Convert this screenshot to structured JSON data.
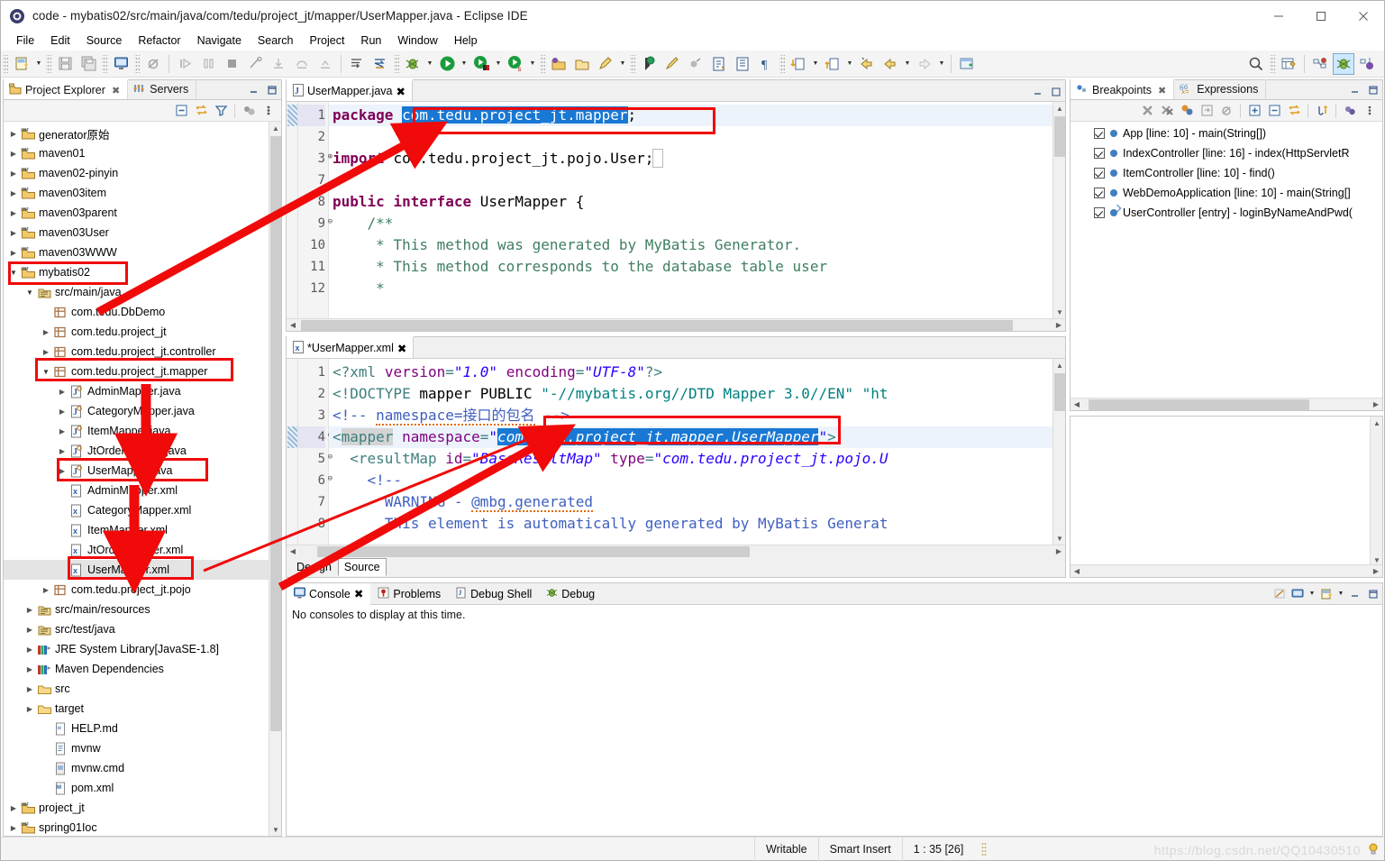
{
  "window": {
    "title": "code - mybatis02/src/main/java/com/tedu/project_jt/mapper/UserMapper.java - Eclipse IDE",
    "minimize": "—",
    "maximize": "□",
    "close": "✕"
  },
  "menu": [
    "File",
    "Edit",
    "Source",
    "Refactor",
    "Navigate",
    "Search",
    "Project",
    "Run",
    "Window",
    "Help"
  ],
  "project_explorer": {
    "tabs": [
      {
        "label": "Project Explorer",
        "icon": "project-explorer-icon",
        "selected": true,
        "close": "✖"
      },
      {
        "label": "Servers",
        "icon": "servers-icon",
        "selected": false
      }
    ],
    "view_buttons": [
      "minimize-view",
      "maximize-view"
    ],
    "toolbar_icons": [
      "collapse-all-icon",
      "link-with-editor-icon",
      "filter-icon",
      "focus-icon",
      "view-menu-icon"
    ],
    "tree": [
      {
        "label": "generator原始",
        "icon": "maven-project-icon",
        "indent": 0,
        "arrow": "collapsed"
      },
      {
        "label": "maven01",
        "icon": "maven-project-icon",
        "indent": 0,
        "arrow": "collapsed"
      },
      {
        "label": "maven02-pinyin",
        "icon": "maven-project-icon",
        "indent": 0,
        "arrow": "collapsed"
      },
      {
        "label": "maven03item",
        "icon": "maven-project-icon",
        "indent": 0,
        "arrow": "collapsed"
      },
      {
        "label": "maven03parent",
        "icon": "maven-project-icon",
        "indent": 0,
        "arrow": "collapsed"
      },
      {
        "label": "maven03User",
        "icon": "maven-project-icon",
        "indent": 0,
        "arrow": "collapsed"
      },
      {
        "label": "maven03WWW",
        "icon": "maven-project-icon",
        "indent": 0,
        "arrow": "collapsed"
      },
      {
        "label": "mybatis02",
        "icon": "maven-project-icon",
        "indent": 0,
        "arrow": "expanded",
        "highlighted": true
      },
      {
        "label": "src/main/java",
        "icon": "source-folder-icon",
        "indent": 1,
        "arrow": "expanded"
      },
      {
        "label": "com.tedu.DbDemo",
        "icon": "package-icon",
        "indent": 2,
        "arrow": "none"
      },
      {
        "label": "com.tedu.project_jt",
        "icon": "package-icon",
        "indent": 2,
        "arrow": "collapsed"
      },
      {
        "label": "com.tedu.project_jt.controller",
        "icon": "package-icon",
        "indent": 2,
        "arrow": "collapsed"
      },
      {
        "label": "com.tedu.project_jt.mapper",
        "icon": "package-icon",
        "indent": 2,
        "arrow": "expanded",
        "highlighted": true
      },
      {
        "label": "AdminMapper.java",
        "icon": "java-interface-icon",
        "indent": 3,
        "arrow": "collapsed"
      },
      {
        "label": "CategoryMapper.java",
        "icon": "java-interface-icon",
        "indent": 3,
        "arrow": "collapsed"
      },
      {
        "label": "ItemMapper.java",
        "icon": "java-interface-icon",
        "indent": 3,
        "arrow": "collapsed"
      },
      {
        "label": "JtOrderMapper.java",
        "icon": "java-interface-icon",
        "indent": 3,
        "arrow": "collapsed"
      },
      {
        "label": "UserMapper.java",
        "icon": "java-interface-icon",
        "indent": 3,
        "arrow": "collapsed",
        "highlighted": true
      },
      {
        "label": "AdminMapper.xml",
        "icon": "xml-file-icon",
        "indent": 3,
        "arrow": "none"
      },
      {
        "label": "CategoryMapper.xml",
        "icon": "xml-file-icon",
        "indent": 3,
        "arrow": "none"
      },
      {
        "label": "ItemMapper.xml",
        "icon": "xml-file-icon",
        "indent": 3,
        "arrow": "none"
      },
      {
        "label": "JtOrderMapper.xml",
        "icon": "xml-file-icon",
        "indent": 3,
        "arrow": "none"
      },
      {
        "label": "UserMapper.xml",
        "icon": "xml-file-icon",
        "indent": 3,
        "arrow": "none",
        "selected": true,
        "highlighted": true
      },
      {
        "label": "com.tedu.project_jt.pojo",
        "icon": "package-icon",
        "indent": 2,
        "arrow": "collapsed"
      },
      {
        "label": "src/main/resources",
        "icon": "source-folder-icon",
        "indent": 1,
        "arrow": "collapsed"
      },
      {
        "label": "src/test/java",
        "icon": "source-folder-icon",
        "indent": 1,
        "arrow": "collapsed"
      },
      {
        "label": "JRE System Library",
        "suffix": " [JavaSE-1.8]",
        "icon": "library-icon",
        "indent": 1,
        "arrow": "collapsed"
      },
      {
        "label": "Maven Dependencies",
        "icon": "library-icon",
        "indent": 1,
        "arrow": "collapsed"
      },
      {
        "label": "src",
        "icon": "folder-icon",
        "indent": 1,
        "arrow": "collapsed"
      },
      {
        "label": "target",
        "icon": "folder-icon",
        "indent": 1,
        "arrow": "collapsed"
      },
      {
        "label": "HELP.md",
        "icon": "markdown-file-icon",
        "indent": 2,
        "arrow": "none"
      },
      {
        "label": "mvnw",
        "icon": "text-file-icon",
        "indent": 2,
        "arrow": "none"
      },
      {
        "label": "mvnw.cmd",
        "icon": "cmd-file-icon",
        "indent": 2,
        "arrow": "none"
      },
      {
        "label": "pom.xml",
        "icon": "maven-pom-icon",
        "indent": 2,
        "arrow": "none"
      },
      {
        "label": "project_jt",
        "icon": "maven-project-icon",
        "indent": 0,
        "arrow": "collapsed"
      },
      {
        "label": "spring01Ioc",
        "icon": "maven-project-icon",
        "indent": 0,
        "arrow": "collapsed"
      }
    ]
  },
  "java_editor": {
    "tab": {
      "label": "UserMapper.java",
      "icon": "java-file-icon",
      "close": "✖"
    },
    "lines": [
      {
        "num": "1",
        "fold": "",
        "current": true
      },
      {
        "num": "2",
        "fold": ""
      },
      {
        "num": "3",
        "fold": "⊕"
      },
      {
        "num": "7",
        "fold": ""
      },
      {
        "num": "8",
        "fold": ""
      },
      {
        "num": "9",
        "fold": "⊖"
      },
      {
        "num": "10",
        "fold": ""
      },
      {
        "num": "11",
        "fold": ""
      },
      {
        "num": "12",
        "fold": ""
      }
    ],
    "code": [
      "package com.tedu.project_jt.mapper;",
      "",
      "import com.tedu.project_jt.pojo.User;",
      "",
      "public interface UserMapper {",
      "    /**",
      "     * This method was generated by MyBatis Generator.",
      "     * This method corresponds to the database table user",
      "     *"
    ],
    "selected_text": "com.tedu.project_jt.mapper"
  },
  "xml_editor": {
    "tab": {
      "label": "*UserMapper.xml",
      "icon": "xml-file-icon",
      "close": "✖"
    },
    "lines": [
      {
        "num": "1",
        "fold": ""
      },
      {
        "num": "2",
        "fold": ""
      },
      {
        "num": "3",
        "fold": ""
      },
      {
        "num": "4",
        "fold": "⊖",
        "current": true
      },
      {
        "num": "5",
        "fold": "⊖"
      },
      {
        "num": "6",
        "fold": "⊖"
      },
      {
        "num": "7",
        "fold": ""
      },
      {
        "num": "8",
        "fold": ""
      }
    ],
    "code": [
      "<?xml version=\"1.0\" encoding=\"UTF-8\"?>",
      "<!DOCTYPE mapper PUBLIC \"-//mybatis.org//DTD Mapper 3.0//EN\" \"ht",
      "<!-- namespace=接口的包名 -->",
      "<mapper namespace=\"com.tedu.project_jt.mapper.UserMapper\">",
      "  <resultMap id=\"BaseResultMap\" type=\"com.tedu.project_jt.pojo.U",
      "    <!--",
      "      WARNING - @mbg.generated",
      "      This element is automatically generated by MyBatis Generat"
    ],
    "selected_text": "com.tedu.project_jt.mapper.UserMapper",
    "bottom_tabs": [
      {
        "label": "Design",
        "selected": false
      },
      {
        "label": "Source",
        "selected": true
      }
    ]
  },
  "breakpoints": {
    "tabs": [
      {
        "label": "Breakpoints",
        "icon": "breakpoints-icon",
        "selected": true,
        "close": "✖"
      },
      {
        "label": "Expressions",
        "icon": "expressions-icon",
        "selected": false
      }
    ],
    "toolbar_icons": [
      "remove-breakpoint-icon",
      "remove-all-breakpoints-icon",
      "link-debug-view-icon",
      "show-in-editor-icon",
      "skip-all-breakpoints-icon",
      "expand-all-icon",
      "collapse-all-icon",
      "link-with-debug-icon",
      "add-java-exception-icon",
      "working-sets-icon",
      "view-menu-icon"
    ],
    "items": [
      {
        "label": "App [line: 10] - main(String[])",
        "checked": true,
        "kind": "line"
      },
      {
        "label": "IndexController [line: 16] - index(HttpServletR",
        "checked": true,
        "kind": "line"
      },
      {
        "label": "ItemController [line: 10] - find()",
        "checked": true,
        "kind": "line"
      },
      {
        "label": "WebDemoApplication [line: 10] - main(String[]",
        "checked": true,
        "kind": "line"
      },
      {
        "label": "UserController [entry] - loginByNameAndPwd(",
        "checked": true,
        "kind": "entry"
      }
    ]
  },
  "console": {
    "tabs": [
      {
        "label": "Console",
        "icon": "console-icon",
        "selected": true,
        "close": "✖"
      },
      {
        "label": "Problems",
        "icon": "problems-icon",
        "selected": false
      },
      {
        "label": "Debug Shell",
        "icon": "debug-shell-icon",
        "selected": false
      },
      {
        "label": "Debug",
        "icon": "debug-icon",
        "selected": false
      }
    ],
    "toolbar_icons": [
      "clear-console-icon",
      "display-selected-console-icon",
      "open-console-icon",
      "minimize-view",
      "maximize-view"
    ],
    "message": "No consoles to display at this time."
  },
  "statusbar": {
    "writable": "Writable",
    "insert_mode": "Smart Insert",
    "cursor_position": "1 : 35 [26]",
    "watermark": "https://blog.csdn.net/QQ10430510"
  },
  "colors": {
    "annotation_red": "#f00a0a",
    "selection_blue": "#1878d4",
    "keyword_purple": "#7f0055",
    "comment_green": "#3f7f5f",
    "string_blue": "#2a00ff",
    "xml_tag_teal": "#3f7f7f",
    "xml_comment_blue": "#3f5fbf"
  }
}
